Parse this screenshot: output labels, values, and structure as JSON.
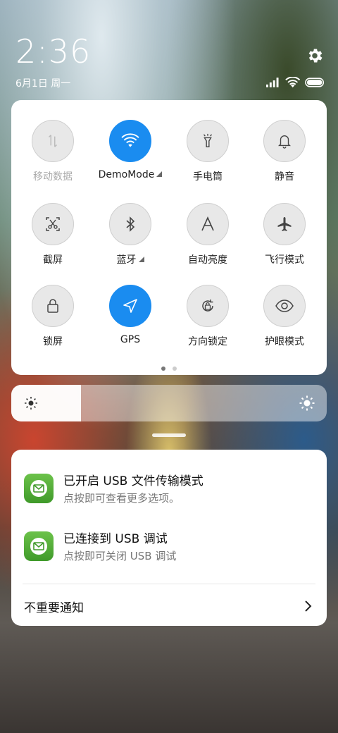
{
  "status_bar": {
    "time": "2:36",
    "date": "6月1日 周一",
    "icons": [
      "signal-icon",
      "wifi-icon",
      "battery-icon"
    ]
  },
  "quick_settings": {
    "tiles": [
      {
        "label": "移动数据",
        "icon": "mobile-data-icon",
        "active": false,
        "disabled": true
      },
      {
        "label": "DemoMode",
        "icon": "wifi-icon",
        "active": true,
        "expandable": true
      },
      {
        "label": "手电筒",
        "icon": "flashlight-icon",
        "active": false
      },
      {
        "label": "静音",
        "icon": "bell-icon",
        "active": false
      },
      {
        "label": "截屏",
        "icon": "screenshot-icon",
        "active": false
      },
      {
        "label": "蓝牙",
        "icon": "bluetooth-icon",
        "active": false,
        "expandable": true
      },
      {
        "label": "自动亮度",
        "icon": "auto-brightness-icon",
        "active": false
      },
      {
        "label": "飞行模式",
        "icon": "airplane-icon",
        "active": false
      },
      {
        "label": "锁屏",
        "icon": "lock-icon",
        "active": false
      },
      {
        "label": "GPS",
        "icon": "location-icon",
        "active": true
      },
      {
        "label": "方向锁定",
        "icon": "rotation-lock-icon",
        "active": false
      },
      {
        "label": "护眼模式",
        "icon": "eye-icon",
        "active": false
      }
    ],
    "page_count": 2,
    "current_page": 1
  },
  "brightness": {
    "level": 0.22
  },
  "notifications": [
    {
      "title": "已开启 USB 文件传输模式",
      "subtitle": "点按即可查看更多选项。",
      "icon": "usb-app-icon"
    },
    {
      "title": "已连接到 USB 调试",
      "subtitle": "点按即可关闭 USB 调试",
      "icon": "usb-app-icon"
    }
  ],
  "unimportant": {
    "label": "不重要通知"
  },
  "colors": {
    "accent": "#1a8cf0",
    "app_icon": "#4caf3a"
  }
}
